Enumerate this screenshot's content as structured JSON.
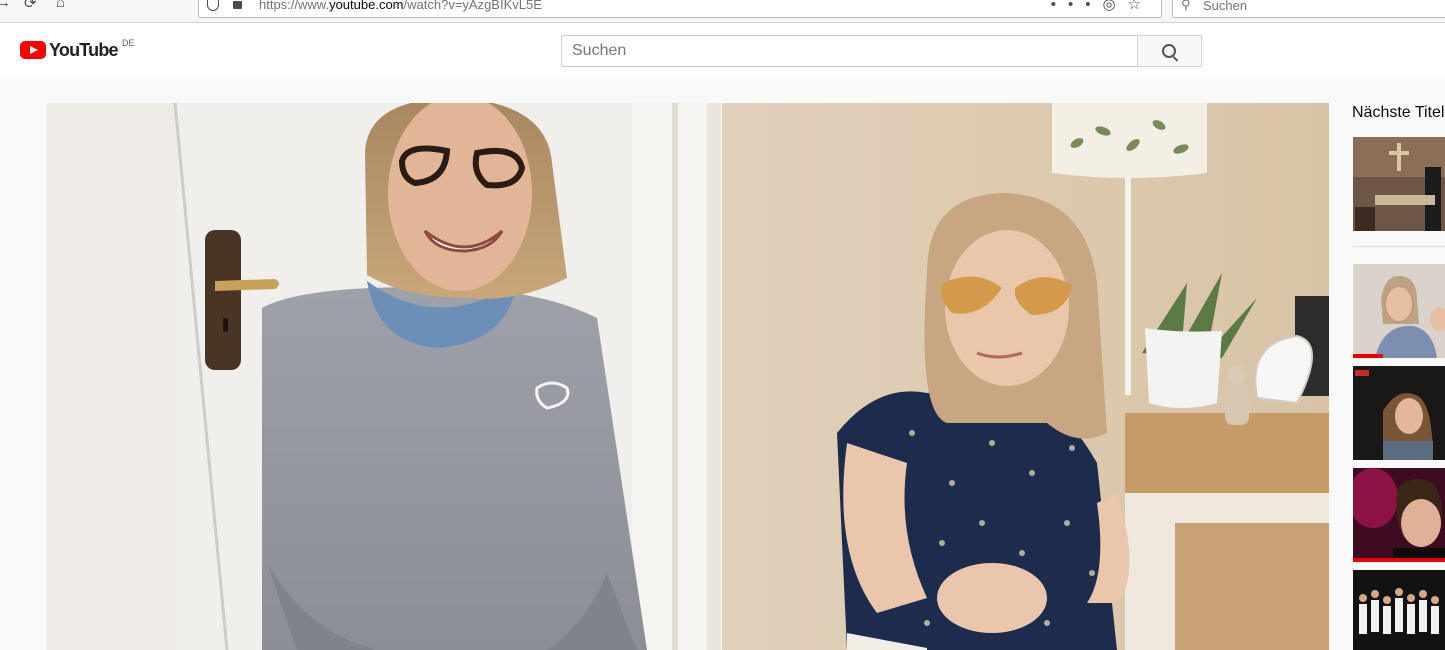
{
  "browser": {
    "url_prefix": "https://www.",
    "url_domain": "youtube.com",
    "url_path": "/watch?v=yAzgBIKvL5E",
    "search_placeholder": "Suchen"
  },
  "masthead": {
    "logo_text": "YouTube",
    "country_code": "DE",
    "search_placeholder": "Suchen"
  },
  "sidebar": {
    "up_next_title": "Nächste Titel"
  },
  "colors": {
    "brand_red": "#ff0000",
    "progress_red": "#e00000"
  }
}
